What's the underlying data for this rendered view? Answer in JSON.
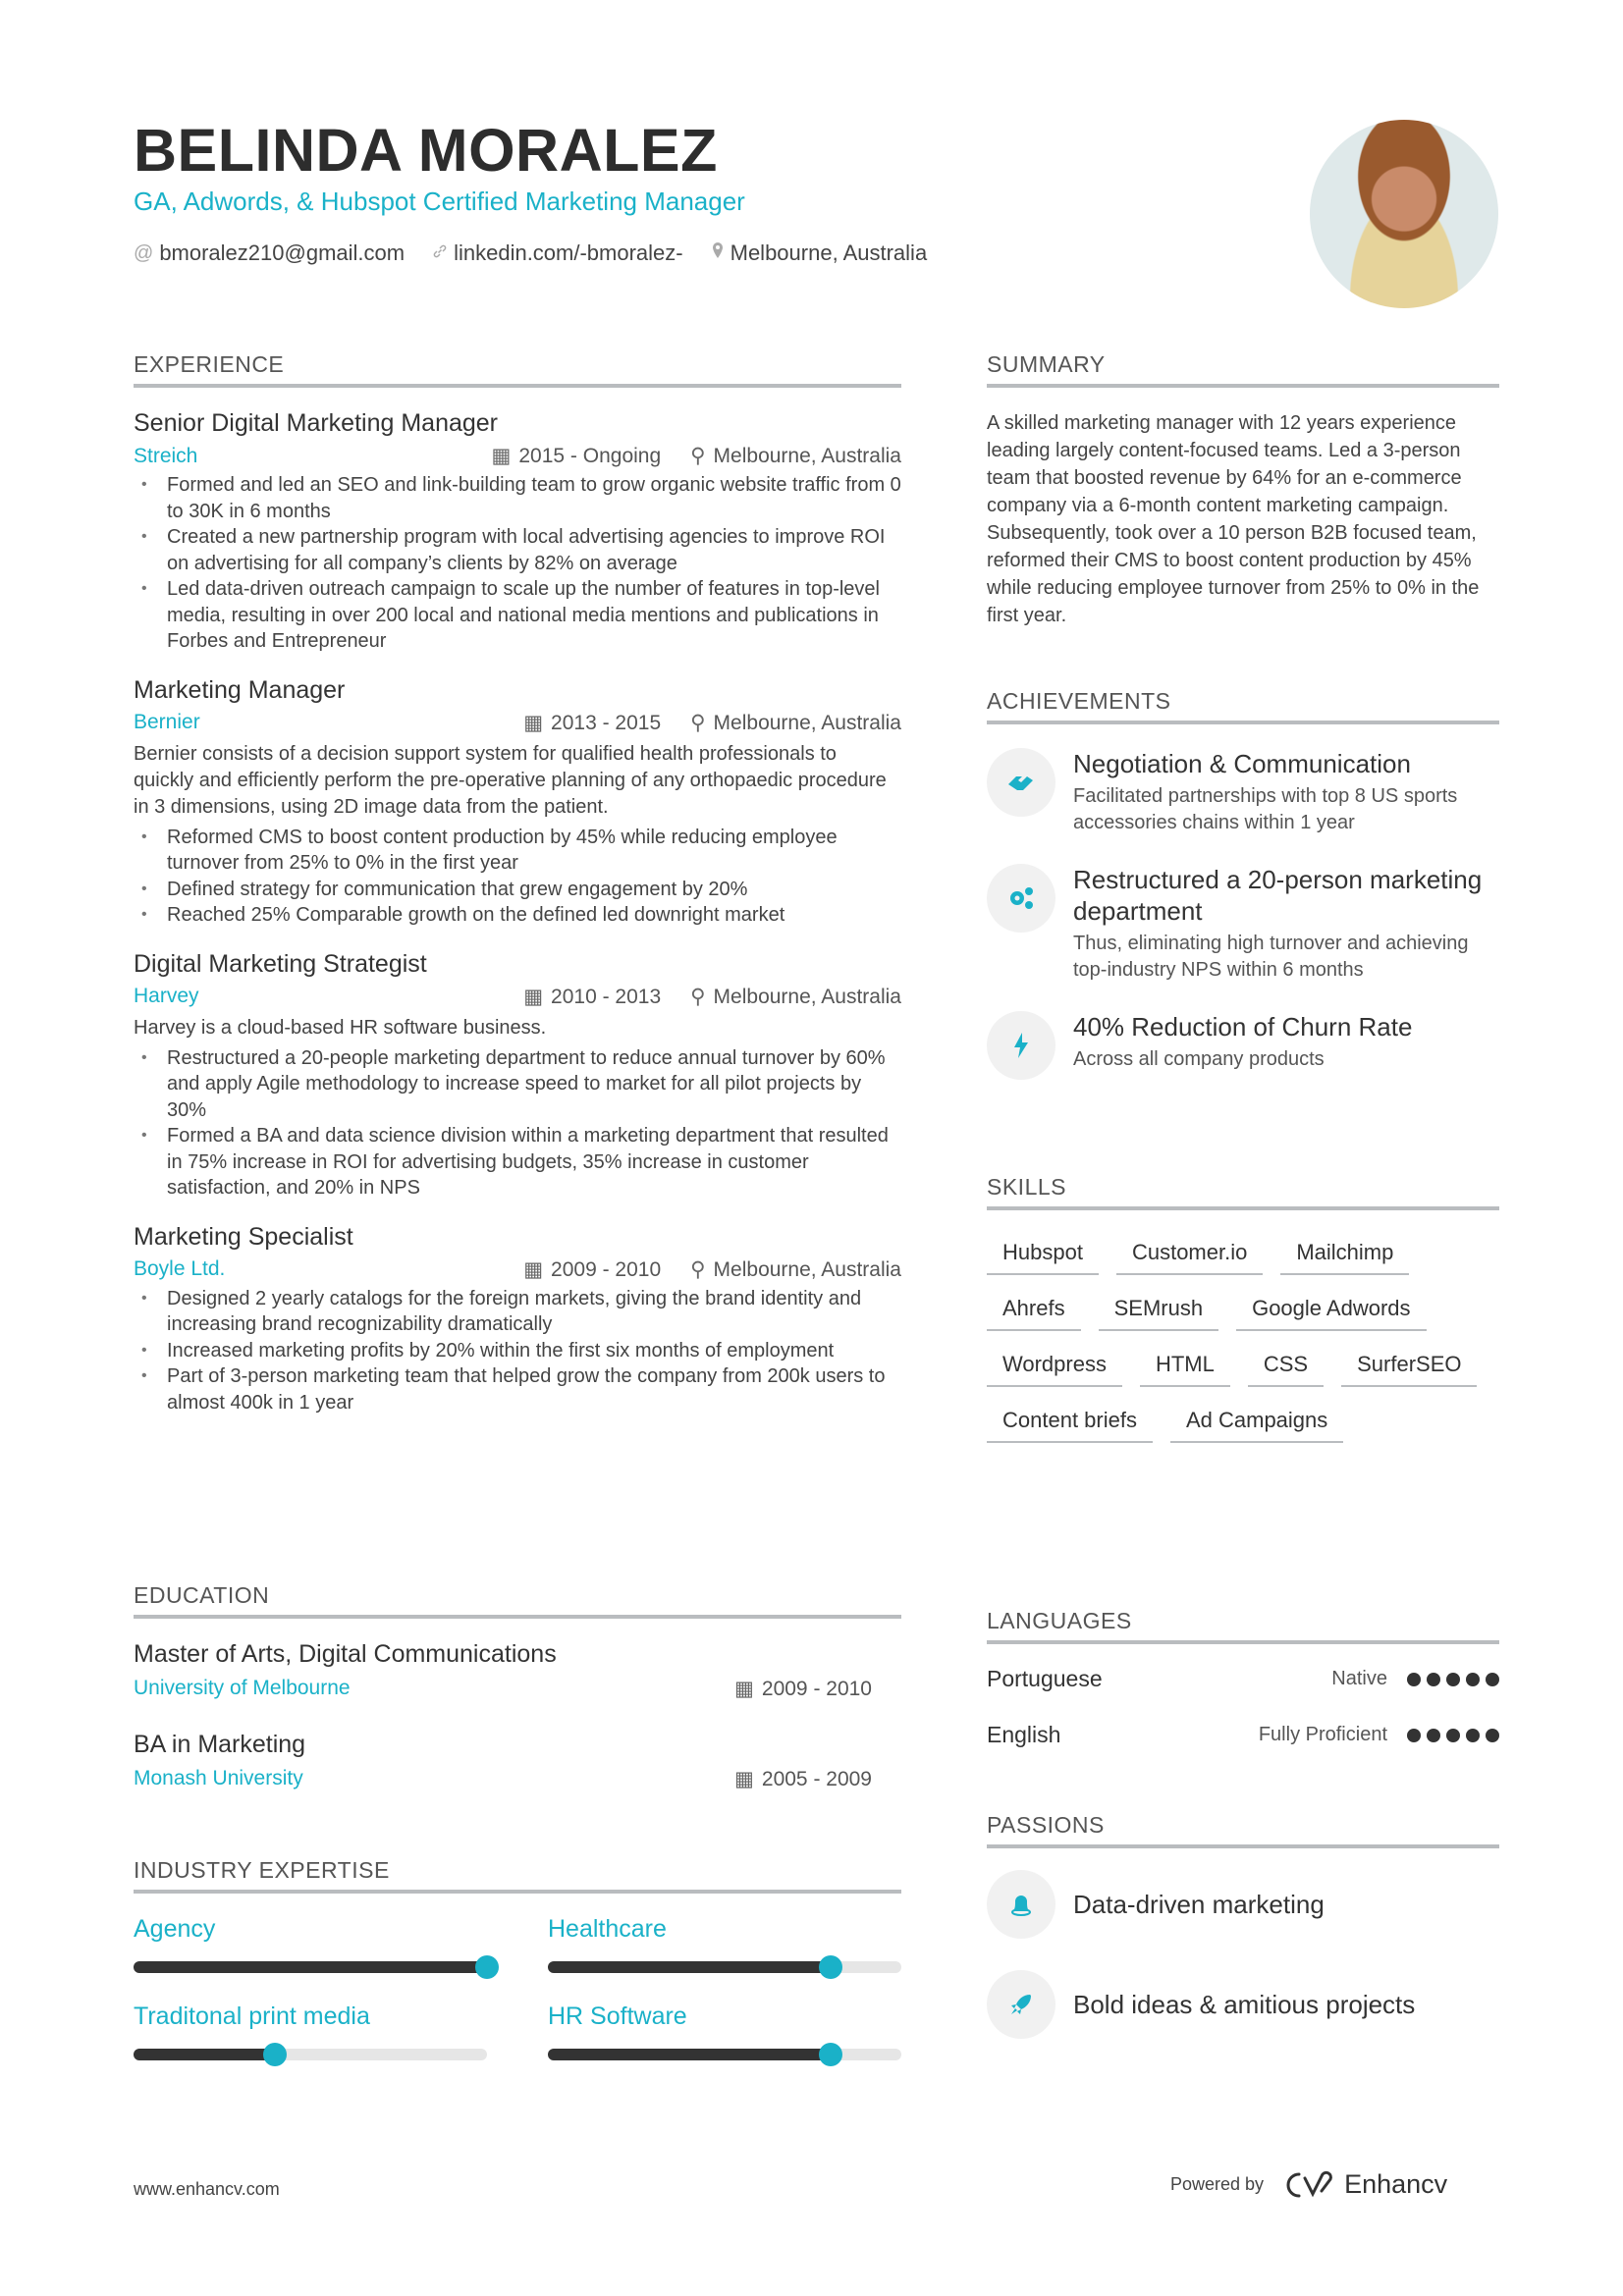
{
  "header": {
    "name": "BELINDA MORALEZ",
    "title": "GA, Adwords, & Hubspot Certified Marketing Manager",
    "contacts": [
      {
        "icon": "at-icon",
        "glyph": "@",
        "text": "bmoralez210@gmail.com"
      },
      {
        "icon": "link-icon",
        "glyph": "🔗",
        "text": "linkedin.com/-bmoralez-"
      },
      {
        "icon": "location-pin-icon",
        "glyph": "⚲",
        "text": "Melbourne, Australia"
      }
    ]
  },
  "sections": {
    "experience": "EXPERIENCE",
    "education": "EDUCATION",
    "industry": "INDUSTRY EXPERTISE",
    "summary": "SUMMARY",
    "achievements": "ACHIEVEMENTS",
    "skills": "SKILLS",
    "languages": "LANGUAGES",
    "passions": "PASSIONS"
  },
  "experience": [
    {
      "title": "Senior Digital Marketing Manager",
      "company": "Streich",
      "dates": "2015 - Ongoing",
      "location": "Melbourne, Australia",
      "description": "",
      "bullets": [
        "Formed and led an SEO and link-building team to grow organic website traffic from 0 to 30K in 6 months",
        "Created a new partnership program with local advertising agencies to improve ROI on advertising for all company’s clients by 82% on average",
        "Led data-driven outreach campaign to scale up the number of features in top-level media, resulting in over 200 local and national media mentions and publications in Forbes and Entrepreneur"
      ]
    },
    {
      "title": "Marketing Manager",
      "company": "Bernier",
      "dates": "2013 - 2015",
      "location": "Melbourne, Australia",
      "description": "Bernier consists of a decision support system for qualified health professionals to quickly and efficiently perform the pre-operative planning of any orthopaedic procedure in 3 dimensions, using 2D image data from the patient.",
      "bullets": [
        "Reformed CMS to boost content production by 45% while reducing employee turnover from 25% to 0% in the first year",
        "Defined strategy for communication that grew engagement by 20%",
        "Reached 25% Comparable growth on the defined led downright market"
      ]
    },
    {
      "title": "Digital Marketing Strategist",
      "company": "Harvey",
      "dates": "2010 - 2013",
      "location": "Melbourne, Australia",
      "description": "Harvey is a cloud-based HR software business.",
      "bullets": [
        "Restructured a 20-people marketing department to reduce annual turnover by 60% and apply Agile methodology to increase speed to market for all pilot projects by 30%",
        "Formed a BA and data science division within a marketing department that resulted in 75% increase in ROI for advertising budgets, 35% increase in customer satisfaction, and 20% in NPS"
      ]
    },
    {
      "title": "Marketing Specialist",
      "company": "Boyle Ltd.",
      "dates": "2009 - 2010",
      "location": "Melbourne, Australia",
      "description": "",
      "bullets": [
        "Designed 2 yearly catalogs for the foreign markets, giving the brand identity and increasing brand recognizability dramatically",
        "Increased marketing profits by 20% within the first six months of employment",
        "Part of 3-person marketing team that helped grow the company from 200k users to almost 400k in 1 year"
      ]
    }
  ],
  "education": [
    {
      "degree": "Master of Arts, Digital Communications",
      "school": "University of Melbourne",
      "dates": "2009 - 2010"
    },
    {
      "degree": "BA in Marketing",
      "school": "Monash University",
      "dates": "2005 - 2009"
    }
  ],
  "industry_expertise": [
    {
      "name": "Agency",
      "level_pct": 100
    },
    {
      "name": "Healthcare",
      "level_pct": 80
    },
    {
      "name": "Traditonal print media",
      "level_pct": 40
    },
    {
      "name": "HR Software",
      "level_pct": 80
    }
  ],
  "summary": "A skilled marketing manager with 12 years experience leading largely content-focused teams. Led a 3-person team that boosted revenue by 64% for an e-commerce company via a 6-month content marketing campaign. Subsequently, took over a 10 person B2B focused team, reformed their CMS to boost content production by 45% while reducing employee turnover from 25% to 0% in the first year.",
  "achievements": [
    {
      "icon": "handshake-icon",
      "glyph": "🤝",
      "title": "Negotiation & Communication",
      "desc": "Facilitated partnerships with top 8 US sports accessories chains within 1 year"
    },
    {
      "icon": "gears-icon",
      "glyph": "⚙",
      "title": "Restructured a 20-person marketing department",
      "desc": "Thus, eliminating high turnover and achieving top-industry NPS within 6 months"
    },
    {
      "icon": "lightning-icon",
      "glyph": "ϟ",
      "title": "40% Reduction of Churn Rate",
      "desc": "Across all company products"
    }
  ],
  "skills": [
    "Hubspot",
    "Customer.io",
    "Mailchimp",
    "Ahrefs",
    "SEMrush",
    "Google Adwords",
    "Wordpress",
    "HTML",
    "CSS",
    "SurferSEO",
    "Content briefs",
    "Ad Campaigns"
  ],
  "languages": [
    {
      "name": "Portuguese",
      "level": "Native",
      "dots_filled": 5,
      "dots_total": 5
    },
    {
      "name": "English",
      "level": "Fully Proficient",
      "dots_filled": 5,
      "dots_total": 5
    }
  ],
  "passions": [
    {
      "icon": "bell-icon",
      "glyph": "🔔",
      "text": "Data-driven marketing"
    },
    {
      "icon": "rocket-icon",
      "glyph": "🚀",
      "text": "Bold ideas & amitious projects"
    }
  ],
  "footer": {
    "website": "www.enhancv.com",
    "powered_by": "Powered by",
    "brand": "Enhancv"
  },
  "colors": {
    "accent": "#1ab1c8",
    "text": "#333333",
    "rule": "#b9bcbf"
  }
}
